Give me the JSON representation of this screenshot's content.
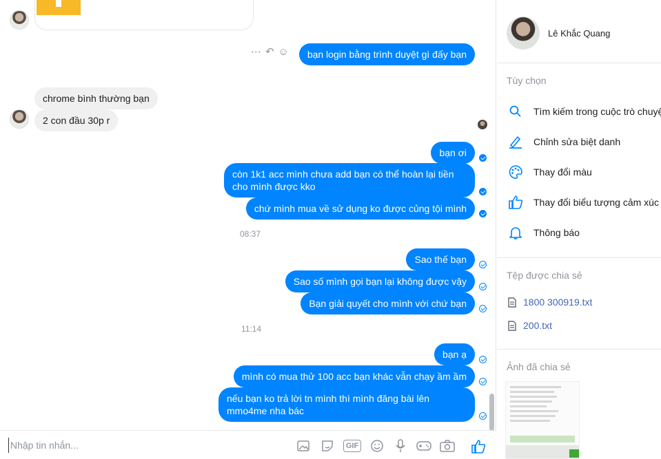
{
  "contact": {
    "name": "Lê Khắc Quang"
  },
  "messages": {
    "m1": "bạn login bằng trình duyệt gì đấy bạn",
    "m2": "chrome bình thường bạn",
    "m3": "2 con đầu 30p r",
    "m4": "bạn ơi",
    "m5": "còn 1k1 acc mình chưa add bạn có thể hoàn lại tiền cho mình được kko",
    "m6": "chứ mình mua về sử dụng ko được củng tội mình",
    "m7": "Sao thế bạn",
    "m8": "Sao số mình gọi bạn lại không được vậy",
    "m9": "Bạn giải quyết cho mình với chứ bạn",
    "m10": "bạn ạ",
    "m11": "mình có mua thử 100 acc bạn khác vẫn chạy ầm ầm",
    "m12": "nếu bạn ko trả lời tn mình thì mình đăng bài lên mmo4me nha bác"
  },
  "timestamps": {
    "t1": "08:37",
    "t2": "11:14"
  },
  "composer": {
    "placeholder": "Nhập tin nhắn..."
  },
  "sidebar": {
    "options_title": "Tùy chọn",
    "options": [
      {
        "label": "Tìm kiếm trong cuộc trò chuyện",
        "icon": "search-icon"
      },
      {
        "label": "Chỉnh sửa biệt danh",
        "icon": "pencil-icon"
      },
      {
        "label": "Thay đổi màu",
        "icon": "palette-icon"
      },
      {
        "label": "Thay đổi biểu tượng cảm xúc",
        "icon": "thumbs-up-icon"
      },
      {
        "label": "Thông báo",
        "icon": "bell-icon"
      }
    ],
    "files_title": "Tệp được chia sẻ",
    "files": [
      "1800 300919.txt",
      "200.txt"
    ],
    "photos_title": "Ảnh đã chia sẻ"
  },
  "colors": {
    "accent": "#0084ff",
    "incoming": "#f1f0f0"
  }
}
